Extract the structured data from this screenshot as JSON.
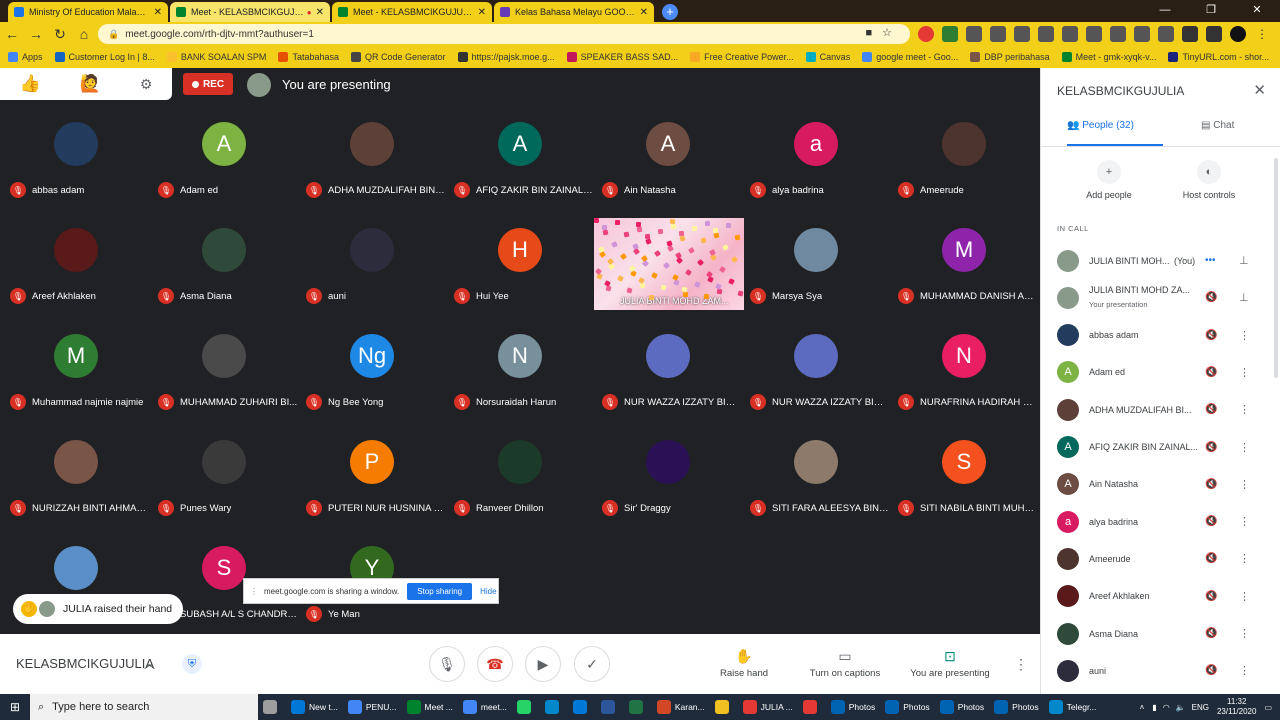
{
  "browser": {
    "tabs": [
      {
        "title": "Ministry Of Education Malaysia -",
        "bg": "#f2d01a",
        "fav": "#1a73e8"
      },
      {
        "title": "Meet - KELASBMCIKGUJULIA",
        "bg": "#f7e46a",
        "fav": "#00832d",
        "rec": true
      },
      {
        "title": "Meet - KELASBMCIKGUJULIA",
        "bg": "#f2d01a",
        "fav": "#00832d"
      },
      {
        "title": "Kelas Bahasa Melayu GOOGLE M",
        "bg": "#f2d01a",
        "fav": "#673ab7"
      }
    ],
    "new_tab": "+",
    "url": "meet.google.com/rth-djtv-mmt?authuser=1",
    "bookmarks": [
      {
        "label": "Apps",
        "color": "#4285f4"
      },
      {
        "label": "Customer Log In | 8...",
        "color": "#1565c0"
      },
      {
        "label": "BANK SOALAN SPM",
        "color": "#fbc02d"
      },
      {
        "label": "Tatabahasa",
        "color": "#e65100"
      },
      {
        "label": "QR Code Generator",
        "color": "#444"
      },
      {
        "label": "https://pajsk.moe.g...",
        "color": "#333"
      },
      {
        "label": "SPEAKER BASS SAD...",
        "color": "#c2185b"
      },
      {
        "label": "Free Creative Power...",
        "color": "#f9a825"
      },
      {
        "label": "Canvas",
        "color": "#00acc1"
      },
      {
        "label": "google meet - Goo...",
        "color": "#4285f4"
      },
      {
        "label": "DBP peribahasa",
        "color": "#795548"
      },
      {
        "label": "Meet - gmk-xyqk-v...",
        "color": "#00832d"
      },
      {
        "label": "TinyURL.com - shor...",
        "color": "#1a237e"
      }
    ]
  },
  "meet": {
    "rec_label": "REC",
    "presenting_label": "You are presenting",
    "participants": [
      {
        "name": "abbas adam",
        "initial": "",
        "color": "#233b5c"
      },
      {
        "name": "Adam ed",
        "initial": "A",
        "color": "#7cb342"
      },
      {
        "name": "ADHA MUZDALIFAH BINT...",
        "initial": "",
        "color": "#5d4037"
      },
      {
        "name": "AFIQ ZAKIR BIN ZAINALA...",
        "initial": "A",
        "color": "#00695c"
      },
      {
        "name": "Ain Natasha",
        "initial": "A",
        "color": "#6d4c41"
      },
      {
        "name": "alya badrina",
        "initial": "a",
        "color": "#d81b60"
      },
      {
        "name": "Ameerude",
        "initial": "",
        "color": "#4e342e"
      },
      {
        "name": "Areef Akhlaken",
        "initial": "",
        "color": "#5a1a1a"
      },
      {
        "name": "Asma Diana",
        "initial": "",
        "color": "#2f4a3a"
      },
      {
        "name": "auni",
        "initial": "",
        "color": "#2c2c3c"
      },
      {
        "name": "Hui Yee",
        "initial": "H",
        "color": "#e64a19"
      },
      {
        "name": "",
        "initial": "",
        "color": "",
        "skip": true
      },
      {
        "name": "Marsya Sya",
        "initial": "",
        "color": "#6f8aa0"
      },
      {
        "name": "MUHAMMAD DANISH AR...",
        "initial": "M",
        "color": "#8e24aa"
      },
      {
        "name": "Muhammad najmie najmie",
        "initial": "M",
        "color": "#2e7d32"
      },
      {
        "name": "MUHAMMAD ZUHAIRI BI...",
        "initial": "",
        "color": "#4a4a4a"
      },
      {
        "name": "Ng Bee Yong",
        "initial": "Ng",
        "color": "#1e88e5"
      },
      {
        "name": "Norsuraidah Harun",
        "initial": "N",
        "color": "#78909c"
      },
      {
        "name": "NUR WAZZA IZZATY BINT...",
        "initial": "",
        "color": "#5c6bc0"
      },
      {
        "name": "NUR WAZZA IZZATY BINT...",
        "initial": "",
        "color": "#5c6bc0"
      },
      {
        "name": "NURAFRINA HADIRAH BI...",
        "initial": "N",
        "color": "#e91e63"
      },
      {
        "name": "NURIZZAH BINTI AHMAD ...",
        "initial": "",
        "color": "#795548"
      },
      {
        "name": "Punes Wary",
        "initial": "",
        "color": "#3a3a3a"
      },
      {
        "name": "PUTERI NUR HUSNINA BI...",
        "initial": "P",
        "color": "#f57c00"
      },
      {
        "name": "Ranveer Dhillon",
        "initial": "",
        "color": "#1b3a2a"
      },
      {
        "name": "Sir' Draggy",
        "initial": "",
        "color": "#2a1055"
      },
      {
        "name": "SITI FARA ALEESYA BINTI...",
        "initial": "",
        "color": "#8d7a6a"
      },
      {
        "name": "SITI NABILA BINTI MUHA...",
        "initial": "S",
        "color": "#f4511e"
      },
      {
        "name": "",
        "initial": "",
        "color": "#5b8fc7",
        "hidden_name": true
      },
      {
        "name": "SUBASH A/L S CHANDRA...",
        "initial": "S",
        "color": "#d81b60"
      },
      {
        "name": "Ye Man",
        "initial": "Y",
        "color": "#33691e"
      }
    ],
    "presenter_tile_name": "JULIA BINTI MOHD ZAM...",
    "raised_hand": "JULIA raised their hand",
    "share_bar": {
      "text": "meet.google.com is sharing a window.",
      "stop": "Stop sharing",
      "hide": "Hide"
    },
    "meeting_name": "KELASBMCIKGUJULIA",
    "actions": {
      "raise": "Raise hand",
      "captions": "Turn on captions",
      "present": "You are presenting"
    }
  },
  "panel": {
    "title": "KELASBMCIKGUJULIA",
    "tab_people": "People (32)",
    "tab_chat": "Chat",
    "add_people": "Add people",
    "host_controls": "Host controls",
    "in_call": "IN CALL",
    "rows": [
      {
        "name": "JULIA BINTI MOH...",
        "suffix": "(You)",
        "initial": "",
        "color": "#8a9a8a",
        "type": "you"
      },
      {
        "name": "JULIA BINTI MOHD ZA...",
        "sub": "Your presentation",
        "initial": "",
        "color": "#8a9a8a",
        "type": "pres"
      },
      {
        "name": "abbas adam",
        "initial": "",
        "color": "#233b5c"
      },
      {
        "name": "Adam ed",
        "initial": "A",
        "color": "#7cb342"
      },
      {
        "name": "ADHA MUZDALIFAH BI...",
        "initial": "",
        "color": "#5d4037"
      },
      {
        "name": "AFIQ ZAKIR BIN ZAINAL...",
        "initial": "A",
        "color": "#00695c"
      },
      {
        "name": "Ain Natasha",
        "initial": "A",
        "color": "#6d4c41"
      },
      {
        "name": "alya badrina",
        "initial": "a",
        "color": "#d81b60"
      },
      {
        "name": "Ameerude",
        "initial": "",
        "color": "#4e342e"
      },
      {
        "name": "Areef Akhlaken",
        "initial": "",
        "color": "#5a1a1a"
      },
      {
        "name": "Asma Diana",
        "initial": "",
        "color": "#2f4a3a"
      },
      {
        "name": "auni",
        "initial": "",
        "color": "#2c2c3c"
      }
    ]
  },
  "taskbar": {
    "search_placeholder": "Type here to search",
    "items": [
      {
        "label": "",
        "color": "#9e9e9e"
      },
      {
        "label": "New t...",
        "color": "#0078d7"
      },
      {
        "label": "PENU...",
        "color": "#4285f4"
      },
      {
        "label": "Meet ...",
        "color": "#00832d"
      },
      {
        "label": "meet...",
        "color": "#4285f4"
      },
      {
        "label": "",
        "color": "#25d366"
      },
      {
        "label": "",
        "color": "#0088cc"
      },
      {
        "label": "",
        "color": "#0078d7"
      },
      {
        "label": "",
        "color": "#2b579a"
      },
      {
        "label": "",
        "color": "#217346"
      },
      {
        "label": "Karan...",
        "color": "#d24726"
      },
      {
        "label": "",
        "color": "#f0c020"
      },
      {
        "label": "JULIA ...",
        "color": "#e53935"
      },
      {
        "label": "",
        "color": "#e53935"
      },
      {
        "label": "Photos",
        "color": "#0063b1"
      },
      {
        "label": "Photos",
        "color": "#0063b1"
      },
      {
        "label": "Photos",
        "color": "#0063b1"
      },
      {
        "label": "Photos",
        "color": "#0063b1"
      },
      {
        "label": "Telegr...",
        "color": "#0088cc"
      }
    ],
    "lang": "ENG",
    "time": "11:32",
    "date": "23/11/2020"
  }
}
